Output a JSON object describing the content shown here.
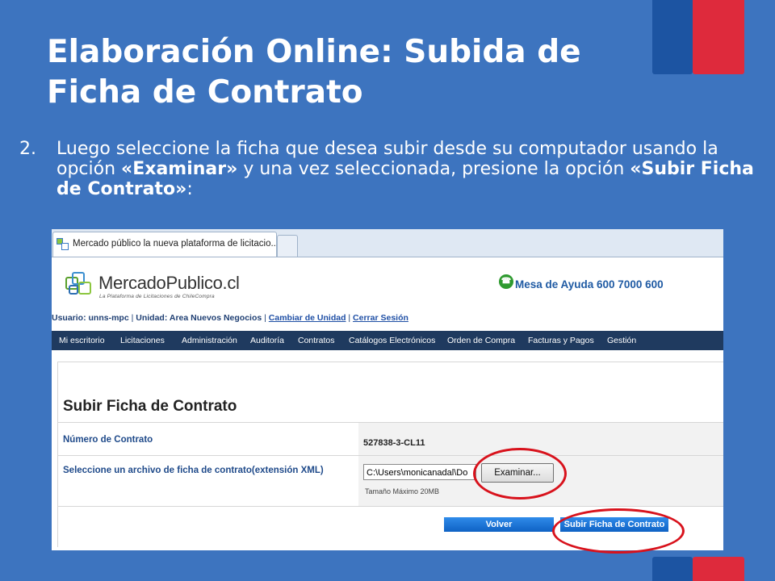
{
  "slide": {
    "title_line1": "Elaboración Online: Subida de",
    "title_line2": "Ficha de Contrato",
    "step_number": "2.",
    "step_text_1": "Luego seleccione la ficha que desea subir desde su computador usando la opción ",
    "step_bold_1": "«Examinar»",
    "step_text_2": " y una vez seleccionada, presione la opción ",
    "step_bold_2": "«Subir Ficha de Contrato»",
    "step_text_3": ":"
  },
  "browser": {
    "tab_label": "Mercado público la nueva plataforma de licitacio..."
  },
  "site": {
    "logo_name": "MercadoPublico.cl",
    "logo_tagline": "La Plataforma de Licitaciones de ChileCompra",
    "help_text": "Mesa de Ayuda 600 7000 600",
    "user_label": "Usuario: unns-mpc",
    "unit_label": "Unidad: Area Nuevos Negocios",
    "change_unit": "Cambiar de Unidad",
    "logout": "Cerrar Sesión",
    "nav": [
      "Mi escritorio",
      "Licitaciones",
      "Administración",
      "Auditoría",
      "Contratos",
      "Catálogos Electrónicos",
      "Orden de Compra",
      "Facturas y Pagos",
      "Gestión"
    ]
  },
  "form": {
    "heading": "Subir Ficha de Contrato",
    "contract_number_label": "Número de Contrato",
    "contract_number_value": "527838-3-CL11",
    "file_label": "Seleccione un archivo de ficha de contrato(extensión XML)",
    "file_value": "C:\\Users\\monicanadal\\Do",
    "browse_label": "Examinar...",
    "max_size": "Tamaño Máximo 20MB",
    "back_label": "Volver",
    "submit_label": "Subir Ficha de Contrato"
  },
  "colors": {
    "background": "#3d74bf",
    "flag_blue": "#1c54a2",
    "flag_red": "#de2a3c",
    "nav_bg": "#1f3a5f",
    "button_blue": "#1a73d9",
    "highlight_red": "#d8121c"
  }
}
